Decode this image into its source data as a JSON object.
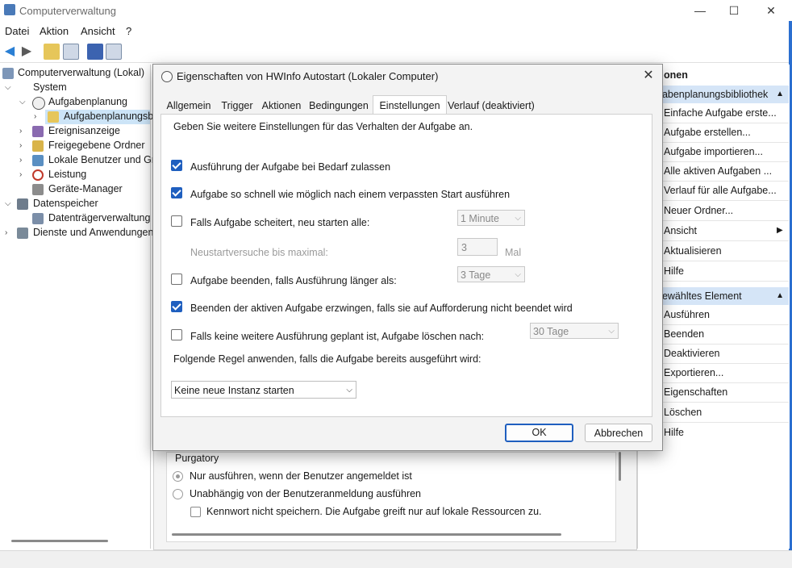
{
  "app": {
    "title": "Computerverwaltung",
    "controls": {
      "minimize": "—",
      "maximize": "☐",
      "close": "✕"
    }
  },
  "menu": [
    "Datei",
    "Aktion",
    "Ansicht",
    "?"
  ],
  "tree": {
    "root": "Computerverwaltung (Lokal)",
    "system": "System",
    "aufgabenplanung": "Aufgabenplanung",
    "aufgabenbibliothek": "Aufgabenplanungsb",
    "ereignisanzeige": "Ereignisanzeige",
    "ordner": "Freigegebene Ordner",
    "benutzer": "Lokale Benutzer und Gr",
    "leistung": "Leistung",
    "geraete": "Geräte-Manager",
    "datenspeicher": "Datenspeicher",
    "datentraeger": "Datenträgerverwaltung",
    "dienste": "Dienste und Anwendungen"
  },
  "actions": {
    "top_header": "onen",
    "section1": "gabenplanungsbibliothek",
    "items1": [
      "Einfache Aufgabe erste...",
      "Aufgabe erstellen...",
      "Aufgabe importieren...",
      "Alle aktiven Aufgaben ...",
      "Verlauf für alle Aufgabe...",
      "Neuer Ordner...",
      "Ansicht",
      "Aktualisieren",
      "Hilfe"
    ],
    "section2": "gewähltes Element",
    "items2": [
      "Ausführen",
      "Beenden",
      "Deaktivieren",
      "Exportieren...",
      "Eigenschaften",
      "Löschen",
      "Hilfe"
    ]
  },
  "background_pane": {
    "user": "Purgatory",
    "radio1": "Nur ausführen, wenn der Benutzer angemeldet ist",
    "radio2": "Unabhängig von der Benutzeranmeldung ausführen",
    "check": "Kennwort nicht speichern. Die Aufgabe greift nur auf lokale Ressourcen zu."
  },
  "dialog": {
    "title": "Eigenschaften von HWInfo Autostart (Lokaler Computer)",
    "close": "✕",
    "tabs": [
      "Allgemein",
      "Trigger",
      "Aktionen",
      "Bedingungen",
      "Einstellungen",
      "Verlauf (deaktiviert)"
    ],
    "active_tab": "Einstellungen",
    "intro": "Geben Sie weitere Einstellungen für das Verhalten der Aufgabe an.",
    "opt1": "Ausführung der Aufgabe bei Bedarf zulassen",
    "opt2": "Aufgabe so schnell wie möglich nach einem verpassten Start ausführen",
    "opt3": "Falls Aufgabe scheitert, neu starten alle:",
    "opt3_value": "1 Minute",
    "retry_label": "Neustartversuche bis maximal:",
    "retry_value": "3",
    "retry_unit": "Mal",
    "opt4": "Aufgabe beenden, falls Ausführung länger als:",
    "opt4_value": "3 Tage",
    "opt5": "Beenden der aktiven Aufgabe erzwingen, falls sie auf Aufforderung nicht beendet wird",
    "opt6": "Falls keine weitere Ausführung geplant ist, Aufgabe löschen nach:",
    "opt6_value": "30 Tage",
    "rule_label": "Folgende Regel anwenden, falls die Aufgabe bereits ausgeführt wird:",
    "rule_value": "Keine neue Instanz starten",
    "ok": "OK",
    "cancel": "Abbrechen"
  }
}
